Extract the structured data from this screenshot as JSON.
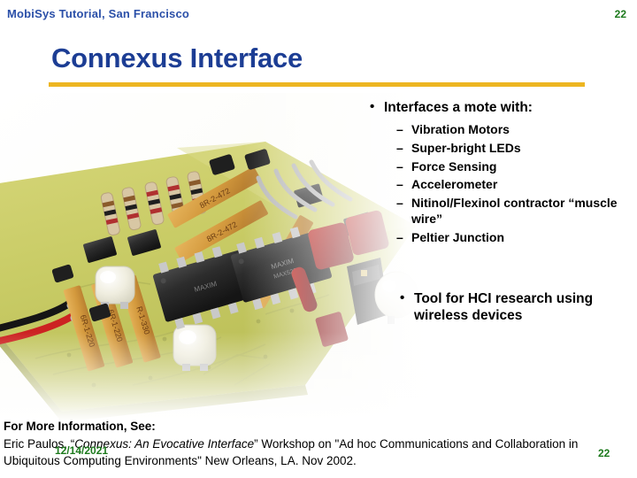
{
  "slide": {
    "header_label": "MobiSys Tutorial, San Francisco",
    "header_page_number": "22",
    "title": "Connexus Interface",
    "accent_color": "#edb521",
    "title_color": "#1c3d94",
    "header_color": "#2a4fa8",
    "page_number_color": "#1d7a1d"
  },
  "body": {
    "bullet_1": {
      "marker": "•",
      "text": "Interfaces a mote with:",
      "sub_marker": "–",
      "sub_items": [
        "Vibration Motors",
        "Super-bright LEDs",
        "Force Sensing",
        "Accelerometer",
        "Nitinol/Flexinol contractor “muscle wire”",
        "Peltier Junction"
      ]
    },
    "bullet_2": {
      "marker": "•",
      "text": "Tool for HCI research using wireless devices"
    }
  },
  "photo": {
    "alt": "Connexus interface printed circuit board photograph",
    "component_labels": {
      "resistor_pack_a": "8R-2-472",
      "resistor_pack_b": "6R-1-220",
      "ic_label": "MAXIM"
    },
    "colors": {
      "pcb_green": "#c8c86a",
      "pcb_green_dark": "#a8ac4e",
      "resistor_pack": "#d9a441",
      "ic_black": "#2b2b2b",
      "capacitor_red": "#a02020",
      "led_white": "#f2f0e4",
      "wire_red": "#cc2222",
      "wire_black": "#1a1a1a"
    }
  },
  "footer": {
    "heading": "For More Information, See:",
    "citation_part_1": "Eric Paulos, “",
    "citation_title": "Connexus: An Evocative Interface",
    "citation_part_2": "”  Workshop on \"Ad hoc Communications and Collaboration in Ubiquitous Computing Environments\"  New Orleans, LA.  Nov 2002.",
    "date": "12/14/2021",
    "page_number": "22"
  }
}
